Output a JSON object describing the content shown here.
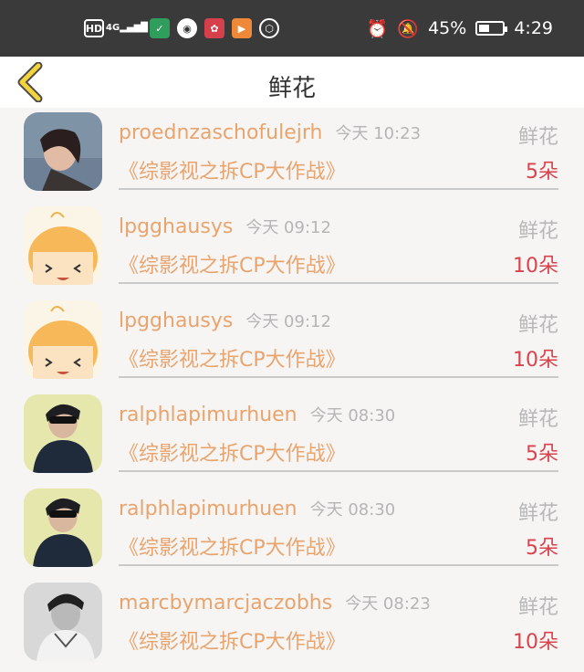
{
  "status_bar": {
    "hd": "HD",
    "signal": "4G",
    "battery_percent": "45%",
    "battery_level": 0.45,
    "time": "4:29"
  },
  "header": {
    "title": "鲜花"
  },
  "records": [
    {
      "username": "proednzaschofulejrh",
      "time": "今天 10:23",
      "type": "鲜花",
      "work": "《综影视之拆CP大作战》",
      "count": "5朵",
      "avatar": "woman-photo"
    },
    {
      "username": "lpgghausys",
      "time": "今天 09:12",
      "type": "鲜花",
      "work": "《综影视之拆CP大作战》",
      "count": "10朵",
      "avatar": "cartoon-face"
    },
    {
      "username": "lpgghausys",
      "time": "今天 09:12",
      "type": "鲜花",
      "work": "《综影视之拆CP大作战》",
      "count": "10朵",
      "avatar": "cartoon-face"
    },
    {
      "username": "ralphlapimurhuen",
      "time": "今天 08:30",
      "type": "鲜花",
      "work": "《综影视之拆CP大作战》",
      "count": "5朵",
      "avatar": "man-sunglasses-photo"
    },
    {
      "username": "ralphlapimurhuen",
      "time": "今天 08:30",
      "type": "鲜花",
      "work": "《综影视之拆CP大作战》",
      "count": "5朵",
      "avatar": "man-sunglasses-photo"
    },
    {
      "username": "marcbymarcjaczobhs",
      "time": "今天 08:23",
      "type": "鲜花",
      "work": "《综影视之拆CP大作战》",
      "count": "10朵",
      "avatar": "man-bw-photo"
    }
  ]
}
